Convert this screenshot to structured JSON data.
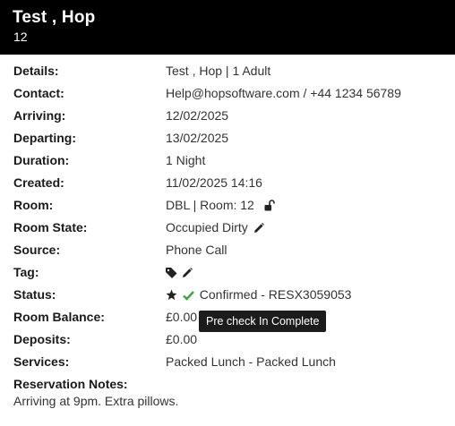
{
  "header": {
    "name": "Test , Hop",
    "room_number": "12"
  },
  "details": {
    "details": {
      "label": "Details:",
      "value": "Test , Hop | 1 Adult"
    },
    "contact": {
      "label": "Contact:",
      "value": "Help@hopsoftware.com / +44 1234 56789"
    },
    "arriving": {
      "label": "Arriving:",
      "value": "12/02/2025"
    },
    "departing": {
      "label": "Departing:",
      "value": "13/02/2025"
    },
    "duration": {
      "label": "Duration:",
      "value": "1 Night"
    },
    "created": {
      "label": "Created:",
      "value": "11/02/2025 14:16"
    },
    "room": {
      "label": "Room:",
      "value": "DBL | Room: 12",
      "icon": "unlock-icon"
    },
    "room_state": {
      "label": "Room State:",
      "value": "Occupied Dirty",
      "icon": "pencil-icon"
    },
    "source": {
      "label": "Source:",
      "value": "Phone Call"
    },
    "tag": {
      "label": "Tag:",
      "icons": [
        "tag-icon",
        "pencil-icon"
      ]
    },
    "status": {
      "label": "Status:",
      "value": "Confirmed - RESX3059053",
      "icons": [
        "star-icon",
        "check-icon"
      ],
      "check_color": "#3aa53a"
    },
    "room_balance": {
      "label": "Room Balance:",
      "value": "£0.00"
    },
    "deposits": {
      "label": "Deposits:",
      "value": "£0.00"
    },
    "services": {
      "label": "Services:",
      "value": "Packed Lunch - Packed Lunch"
    }
  },
  "tooltip": {
    "text": "Pre check In Complete"
  },
  "notes": {
    "label": "Reservation Notes:",
    "text": "Arriving at 9pm. Extra pillows."
  }
}
